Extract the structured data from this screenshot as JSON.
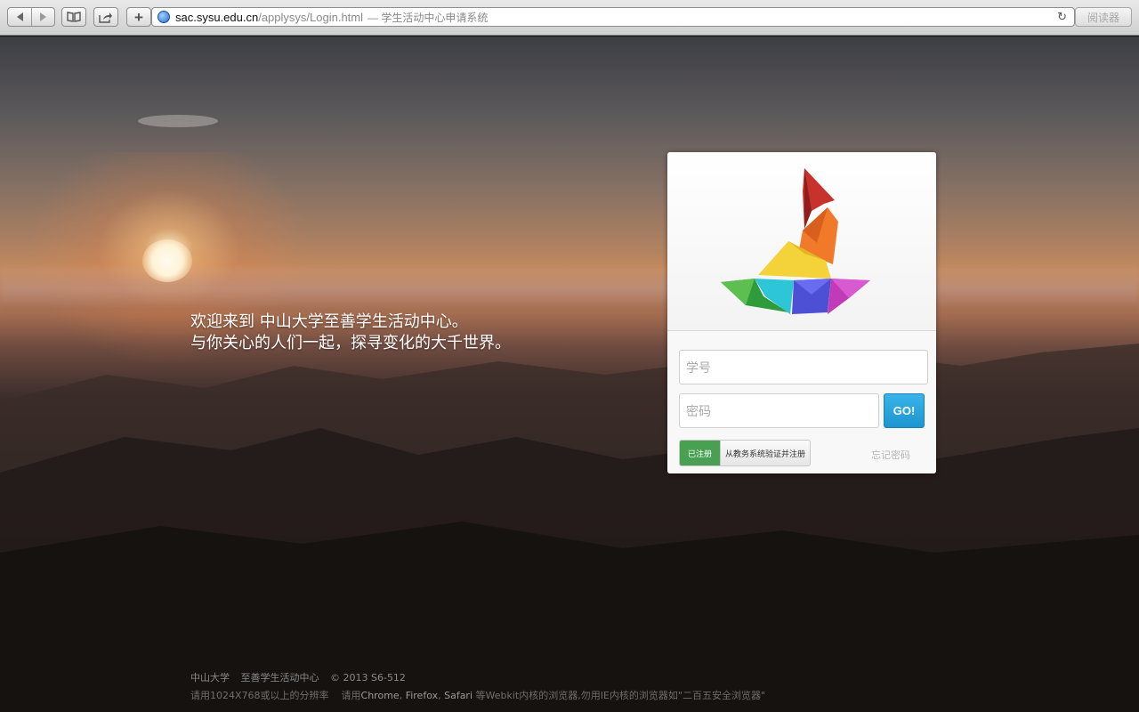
{
  "browser": {
    "url_domain": "sac.sysu.edu.cn",
    "url_path": "/applysys/Login.html",
    "page_title": "— 学生活动中心申请系统",
    "reader_label": "阅读器",
    "new_tab_glyph": "+",
    "reload_glyph": "↻"
  },
  "welcome": {
    "line1": "欢迎来到 中山大学至善学生活动中心。",
    "line2": "与你关心的人们一起，探寻变化的大千世界。"
  },
  "login": {
    "id_placeholder": "学号",
    "password_placeholder": "密码",
    "go_label": "GO!",
    "registered_label": "已注册",
    "verify_register_label": "从教务系统验证并注册",
    "forgot_label": "忘记密码"
  },
  "footer": {
    "university": "中山大学",
    "center": "至善学生活动中心",
    "copyright": "© 2013 S6-512",
    "resolution_note": "请用1024X768或以上的分辨率",
    "browser_note_prefix": "请用",
    "browser_chrome": "Chrome",
    "browser_sep1": ", ",
    "browser_firefox": "Firefox",
    "browser_sep2": ", ",
    "browser_safari": "Safari",
    "browser_note_suffix": " 等Webkit内核的浏览器,勿用IE内核的浏览器如\"二百五安全浏览器\""
  },
  "icons": {
    "back": "back-arrow-icon",
    "forward": "forward-arrow-icon",
    "bookmarks": "book-icon",
    "share": "share-icon",
    "globe": "globe-icon",
    "reload": "reload-icon",
    "logo": "sailboat-logo-icon"
  },
  "colors": {
    "go_button": "#1d96d1",
    "registered_tab": "#4aa052"
  }
}
